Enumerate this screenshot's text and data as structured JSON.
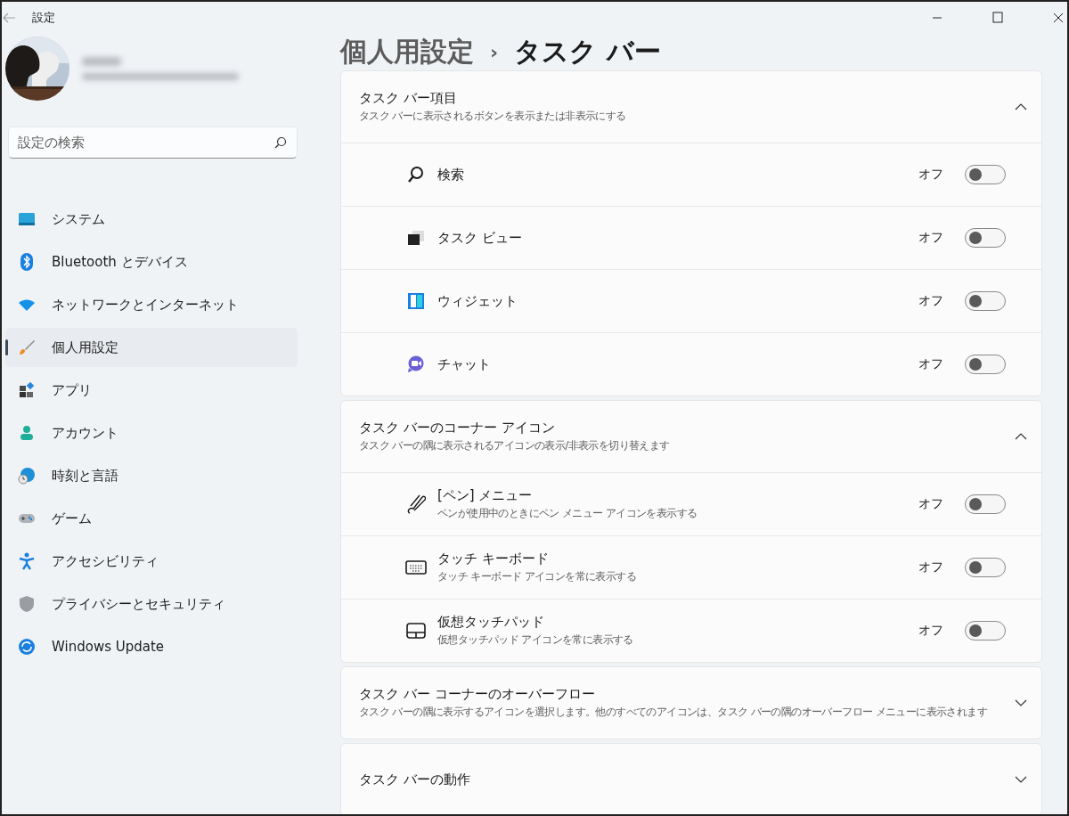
{
  "window": {
    "title": "設定"
  },
  "search": {
    "placeholder": "設定の検索"
  },
  "sidebar": {
    "items": [
      {
        "label": "システム",
        "selected": false
      },
      {
        "label": "Bluetooth とデバイス",
        "selected": false
      },
      {
        "label": "ネットワークとインターネット",
        "selected": false
      },
      {
        "label": "個人用設定",
        "selected": true
      },
      {
        "label": "アプリ",
        "selected": false
      },
      {
        "label": "アカウント",
        "selected": false
      },
      {
        "label": "時刻と言語",
        "selected": false
      },
      {
        "label": "ゲーム",
        "selected": false
      },
      {
        "label": "アクセシビリティ",
        "selected": false
      },
      {
        "label": "プライバシーとセキュリティ",
        "selected": false
      },
      {
        "label": "Windows Update",
        "selected": false
      }
    ]
  },
  "breadcrumb": {
    "separator": "›",
    "parent": "個人用設定",
    "current": "タスク バー"
  },
  "sections": [
    {
      "title": "タスク バー項目",
      "description": "タスク バーに表示されるボタンを表示または非表示にする",
      "expanded": true,
      "rows": [
        {
          "label": "検索",
          "state_label": "オフ",
          "on": false
        },
        {
          "label": "タスク ビュー",
          "state_label": "オフ",
          "on": false
        },
        {
          "label": "ウィジェット",
          "state_label": "オフ",
          "on": false
        },
        {
          "label": "チャット",
          "state_label": "オフ",
          "on": false
        }
      ]
    },
    {
      "title": "タスク バーのコーナー アイコン",
      "description": "タスク バーの隅に表示されるアイコンの表示/非表示を切り替えます",
      "expanded": true,
      "rows": [
        {
          "label": "[ペン] メニュー",
          "description": "ペンが使用中のときにペン メニュー アイコンを表示する",
          "state_label": "オフ",
          "on": false
        },
        {
          "label": "タッチ キーボード",
          "description": "タッチ キーボード アイコンを常に表示する",
          "state_label": "オフ",
          "on": false
        },
        {
          "label": "仮想タッチパッド",
          "description": "仮想タッチパッド アイコンを常に表示する",
          "state_label": "オフ",
          "on": false
        }
      ]
    },
    {
      "title": "タスク バー コーナーのオーバーフロー",
      "description": "タスク バーの隅に表示するアイコンを選択します。他のすべてのアイコンは、タスク バーの隅のオーバーフロー メニューに表示されます",
      "expanded": false
    },
    {
      "title": "タスク バーの動作",
      "expanded": false
    }
  ]
}
